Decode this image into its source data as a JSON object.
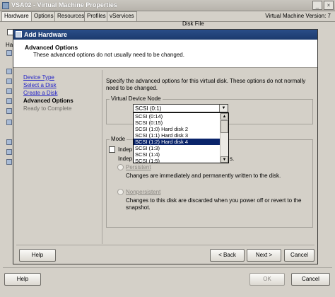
{
  "outer": {
    "title": "VSA02 - Virtual Machine Properties",
    "tabs": [
      {
        "label": "Hardware"
      },
      {
        "label": "Options"
      },
      {
        "label": "Resources"
      },
      {
        "label": "Profiles"
      },
      {
        "label": "vServices"
      }
    ],
    "vm_version": "Virtual Machine Version: 7",
    "disk_file_label": "Disk File",
    "side_labels": {
      "ha": "Ha"
    },
    "help_label": "Help",
    "ok_label": "OK",
    "cancel_label": "Cancel"
  },
  "dialog": {
    "title": "Add Hardware",
    "header_title": "Advanced Options",
    "header_subtitle": "These advanced options do not usually need to be changed.",
    "steps": [
      {
        "label": "Device Type"
      },
      {
        "label": "Select a Disk"
      },
      {
        "label": "Create a Disk"
      },
      {
        "label": "Advanced Options"
      },
      {
        "label": "Ready to Complete"
      }
    ],
    "description": "Specify the advanced options for this virtual disk. These options do not normally need to be changed.",
    "vdn": {
      "legend": "Virtual Device Node",
      "selected": "SCSI (0:1)",
      "options": [
        "SCSI (0:14)",
        "SCSI (0:15)",
        "SCSI (1:0) Hard disk 2",
        "SCSI (1:1) Hard disk 3",
        "SCSI (1:2) Hard disk 4",
        "SCSI (1:3)",
        "SCSI (1:4)",
        "SCSI (1:5)"
      ],
      "highlighted_option": "SCSI (1:2) Hard disk 4"
    },
    "mode": {
      "legend": "Mode",
      "independent_label_part": "Indep",
      "independent_desc_part": "Indep",
      "independent_desc_suffix": "s.",
      "persistent_label": "Persistent",
      "persistent_desc": "Changes are immediately and permanently written to the disk.",
      "nonpersistent_label": "Nonpersistent",
      "nonpersistent_desc": "Changes to this disk are discarded when you power off or revert to the snapshot."
    },
    "help_label": "Help",
    "back_label": "< Back",
    "next_label": "Next >",
    "cancel_label": "Cancel"
  },
  "colors": {
    "dialog_title_bar": "#1c3a6d",
    "selection": "#0a246a",
    "link": "#2323c8"
  },
  "icons": {
    "app": "vm-properties-icon",
    "minimize": "minimize-icon",
    "close": "close-icon",
    "dropdown": "chevron-down-icon"
  }
}
